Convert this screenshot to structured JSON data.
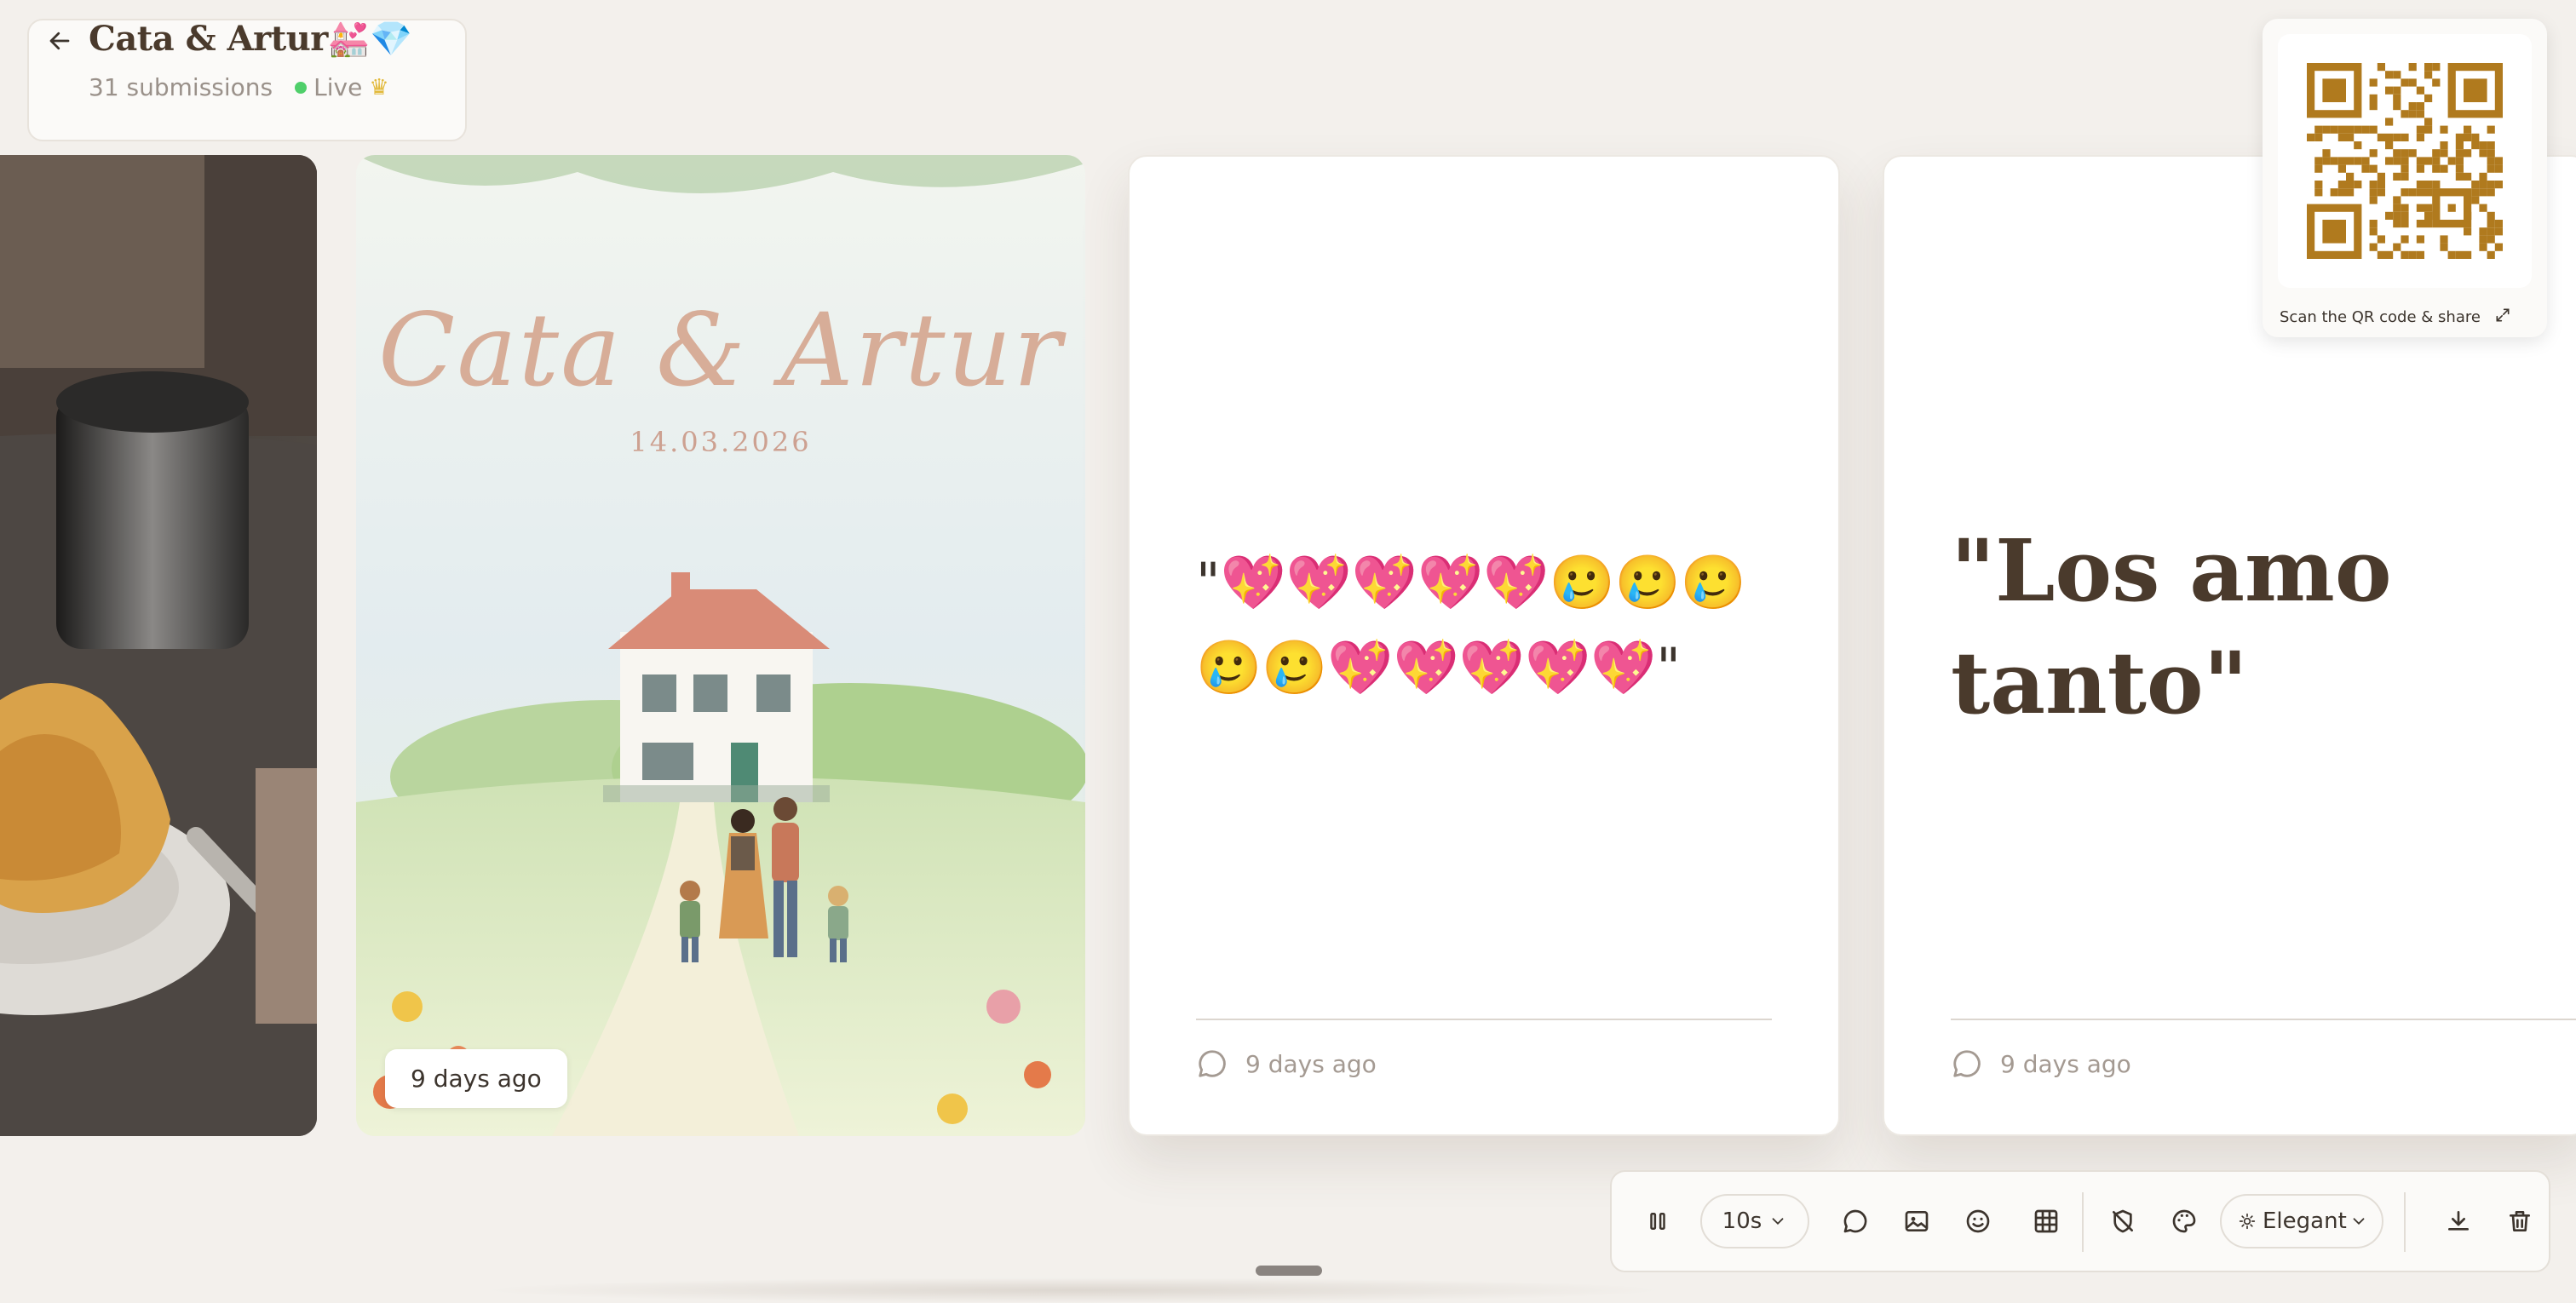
{
  "header": {
    "back_icon": "arrow-left-icon",
    "title": "Cata & Artur💒💎",
    "submissions": "31 submissions",
    "status": "Live",
    "status_color": "#4fcf6a",
    "crown_glyph": "♛"
  },
  "cards": {
    "invite": {
      "title": "Cata & Artur",
      "date": "14.03.2026",
      "timestamp": "9 days ago"
    },
    "text1": {
      "message": "\"💖💖💖💖💖🥲🥲🥲🥲🥲💖💖💖💖💖\"",
      "timestamp": "9 days ago"
    },
    "text2": {
      "message": "\"Los amo tanto\"",
      "timestamp": "9 days ago"
    }
  },
  "qr": {
    "caption": "Scan the QR code & share",
    "color": "#b07a1e"
  },
  "toolbar": {
    "interval": "10s",
    "theme": "Elegant",
    "icons": [
      "pause-icon",
      "comment-icon",
      "image-icon",
      "emoji-icon",
      "grid-icon",
      "no-moderation-icon",
      "palette-icon",
      "download-icon",
      "trash-icon"
    ]
  },
  "colors": {
    "background": "#f3f0ec",
    "accent_brown": "#4a3a2c"
  }
}
